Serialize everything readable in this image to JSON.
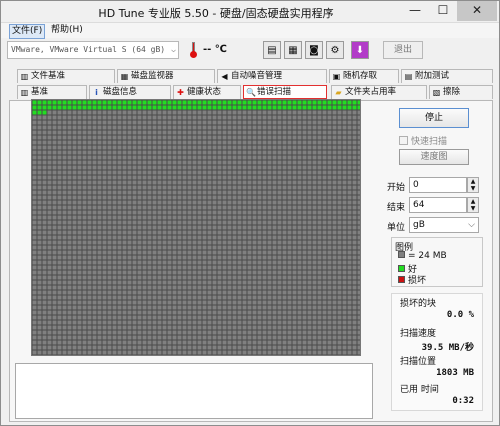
{
  "window": {
    "title": "HD Tune 专业版 5.50 - 硬盘/固态硬盘实用程序",
    "min": "—",
    "max": "☐",
    "close": "✕"
  },
  "menu": [
    "文件(F)",
    "帮助(H)"
  ],
  "toolbar": {
    "drive": "VMware, VMware Virtual S (64 gB)",
    "temperature": "-- ℃",
    "exit_label": "退出"
  },
  "tabs_row1": [
    {
      "label": "文件基准",
      "icon": "benchmark-icon"
    },
    {
      "label": "磁盘监视器",
      "icon": "monitor-icon"
    },
    {
      "label": "自动噪音管理",
      "icon": "speaker-icon"
    },
    {
      "label": "随机存取",
      "icon": "random-access-icon"
    },
    {
      "label": "附加测试",
      "icon": "extra-tests-icon"
    }
  ],
  "tabs_row2": [
    {
      "label": "基准",
      "icon": "benchmark-icon"
    },
    {
      "label": "磁盘信息",
      "icon": "info-icon"
    },
    {
      "label": "健康状态",
      "icon": "health-icon"
    },
    {
      "label": "错误扫描",
      "icon": "search-icon",
      "active": true
    },
    {
      "label": "文件夹占用率",
      "icon": "folder-icon"
    },
    {
      "label": "擦除",
      "icon": "erase-icon"
    }
  ],
  "scan": {
    "stop_label": "停止",
    "quick_scan_label": "快速扫描",
    "speed_map_label": "速度图",
    "start_label": "开始",
    "start_value": "0",
    "end_label": "结束",
    "end_value": "64",
    "unit_label": "单位",
    "unit_value": "gB",
    "progress": 0.04
  },
  "legend": {
    "title": "图例",
    "block": "= 24 MB",
    "good": "好",
    "bad": "损坏"
  },
  "stats": {
    "damaged_label": "损坏的块",
    "damaged_value": "0.0 %",
    "speed_label": "扫描速度",
    "speed_value": "39.5 MB/秒",
    "position_label": "扫描位置",
    "position_value": "1803 MB",
    "elapsed_label": "已用 时间",
    "elapsed_value": "0:32"
  },
  "colors": {
    "grid_unscanned": "#808080",
    "grid_good": "#22dd22",
    "grid_bad": "#cc1111",
    "grid_lines": "#4a4a4a",
    "tab_active_border": "#e23030"
  }
}
